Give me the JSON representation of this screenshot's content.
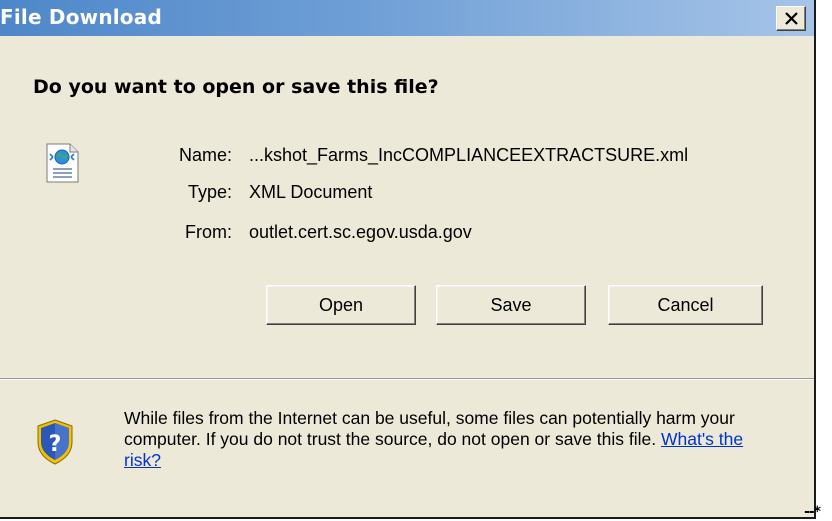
{
  "window": {
    "title": "File Download",
    "close_icon": "close-icon"
  },
  "dialog": {
    "question": "Do you want to open or save this file?",
    "file_icon": "xml-document-icon",
    "fields": [
      {
        "label": "Name:",
        "value": "...kshot_Farms_IncCOMPLIANCEEXTRACTSURE.xml"
      },
      {
        "label": "Type:",
        "value": "XML Document"
      },
      {
        "label": "From:",
        "value": "outlet.cert.sc.egov.usda.gov"
      }
    ],
    "buttons": {
      "open_label": "Open",
      "save_label": "Save",
      "cancel_label": "Cancel"
    },
    "warning": {
      "icon": "shield-question-icon",
      "text": "While files from the Internet can be useful, some files can potentially harm your computer. If you do not trust the source, do not open or save this file.",
      "link_label": "What's the risk?"
    }
  },
  "outside_mark": "--*",
  "colors": {
    "titlebar_start": "#4e87c9",
    "titlebar_end": "#a6c4e8",
    "dialog_bg": "#ece9d8",
    "link": "#0033cc"
  }
}
